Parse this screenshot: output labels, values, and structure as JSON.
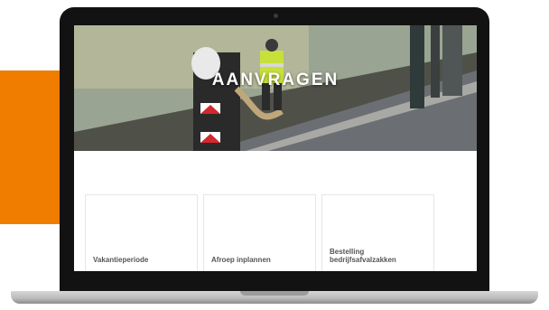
{
  "hero": {
    "title": "AANVRAGEN"
  },
  "tiles": [
    {
      "label": "Vakantieperiode"
    },
    {
      "label": "Afroep inplannen"
    },
    {
      "label": "Bestelling bedrijfsafvalzakken"
    }
  ],
  "colors": {
    "accent": "#f07d00",
    "laptop_frame": "#121212",
    "tile_text": "#555555"
  }
}
